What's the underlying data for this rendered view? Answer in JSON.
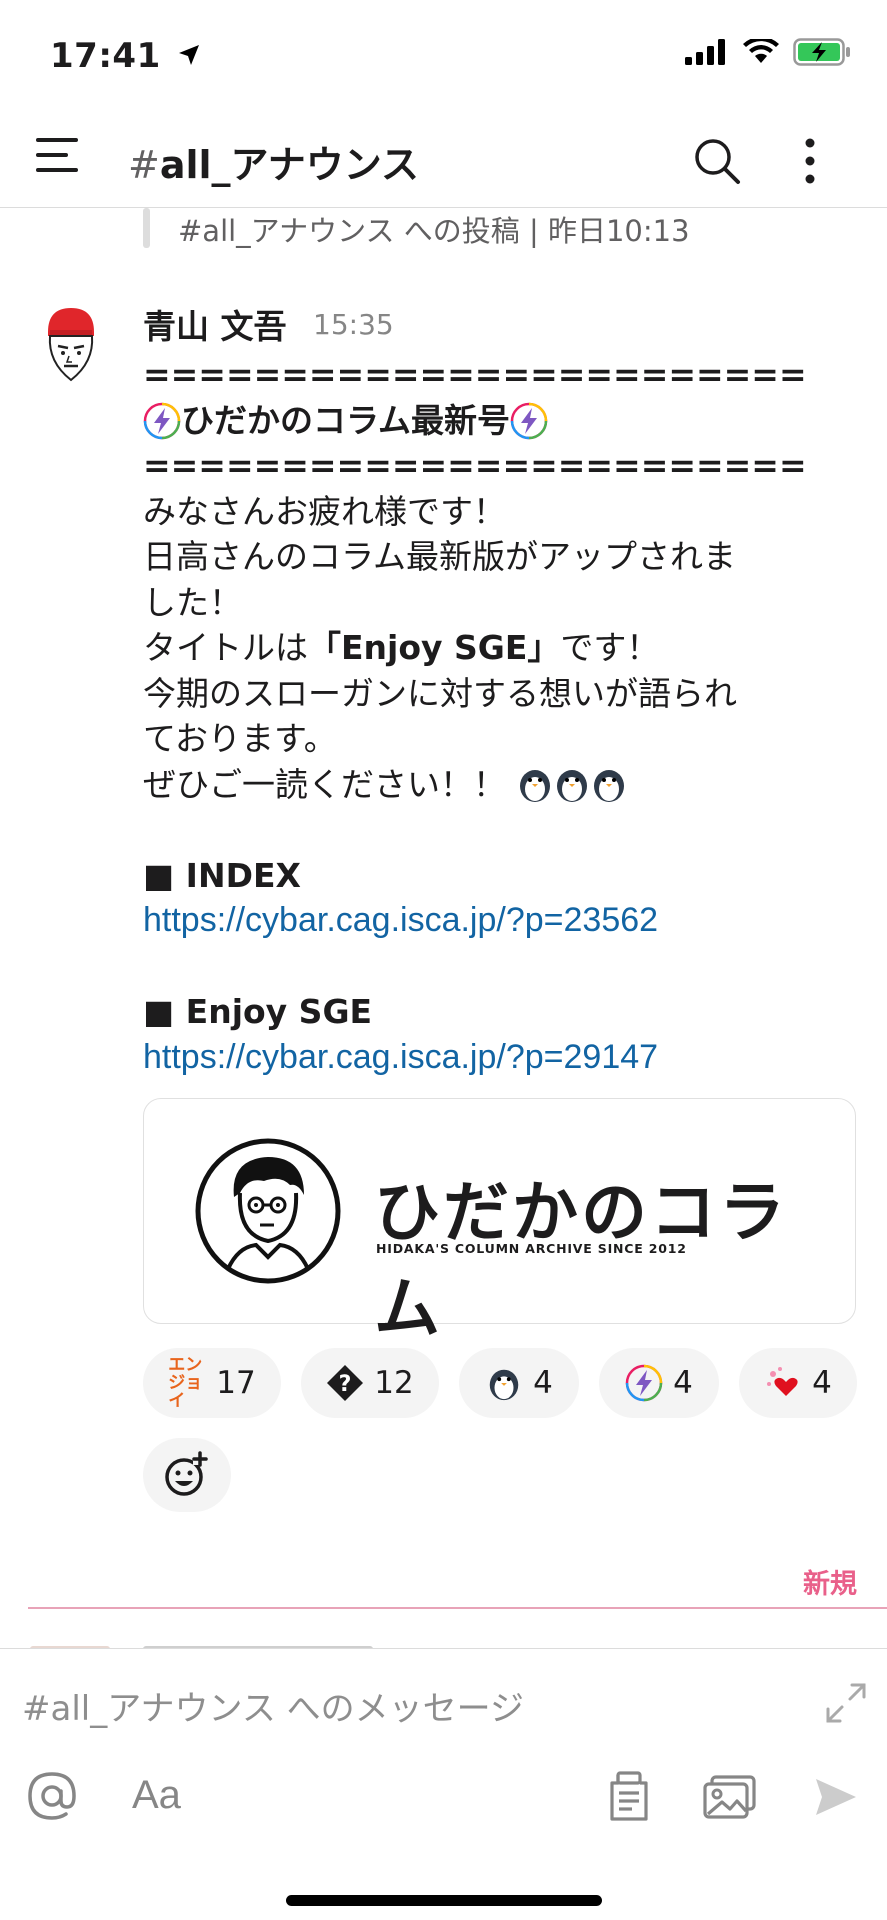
{
  "status_bar": {
    "time": "17:41",
    "icons": [
      "location-arrow-icon",
      "signal-icon",
      "wifi-icon",
      "battery-charging-icon"
    ]
  },
  "header": {
    "hash": "#",
    "channel": "all_アナウンス",
    "icons": [
      "hamburger-menu-icon",
      "search-icon",
      "more-vertical-icon"
    ]
  },
  "quoted_reference": {
    "text": "#all_アナウンス への投稿 | 昨日10:13"
  },
  "message": {
    "author": "青山 文吾",
    "time": "15:35",
    "lines": {
      "divider_top": "========================",
      "heading": "ひだかのコラム最新号",
      "divider_bottom": "========================",
      "l1": "みなさんお疲れ様です！",
      "l2": "日高さんのコラム最新版がアップされま",
      "l3": "した！",
      "l4_pre": "タイトルは",
      "l4_bold": "「Enjoy SGE」",
      "l4_post": "です！",
      "l5": "今期のスローガンに対する想いが語られ",
      "l6": "ております。",
      "l7": "ぜひご一読ください！！",
      "index_label": "■ INDEX",
      "index_link": "https://cybar.cag.isca.jp/?p=23562",
      "enjoy_label": "■ Enjoy SGE",
      "enjoy_link": "https://cybar.cag.isca.jp/?p=29147"
    },
    "emoji": [
      "bolt-emoji",
      "penguin-emoji"
    ]
  },
  "link_preview": {
    "title": "ひだかのコラム",
    "subtitle": "HIDAKA'S COLUMN ARCHIVE SINCE 2012"
  },
  "reactions": [
    {
      "emoji": "enjoy-emoji",
      "emoji_text": "エンジョイ",
      "count": "17"
    },
    {
      "emoji": "question-diamond-emoji",
      "count": "12"
    },
    {
      "emoji": "penguin-emoji",
      "count": "4"
    },
    {
      "emoji": "bolt-emoji",
      "count": "4"
    },
    {
      "emoji": "sparkle-heart-emoji",
      "count": "4"
    }
  ],
  "new_label": "新規",
  "composer": {
    "placeholder": "#all_アナウンス へのメッセージ",
    "format_label": "Aa"
  },
  "colors": {
    "link": "#1264a3",
    "new_marker": "#e01e5a",
    "text": "#1d1c1d",
    "muted": "#616061"
  }
}
